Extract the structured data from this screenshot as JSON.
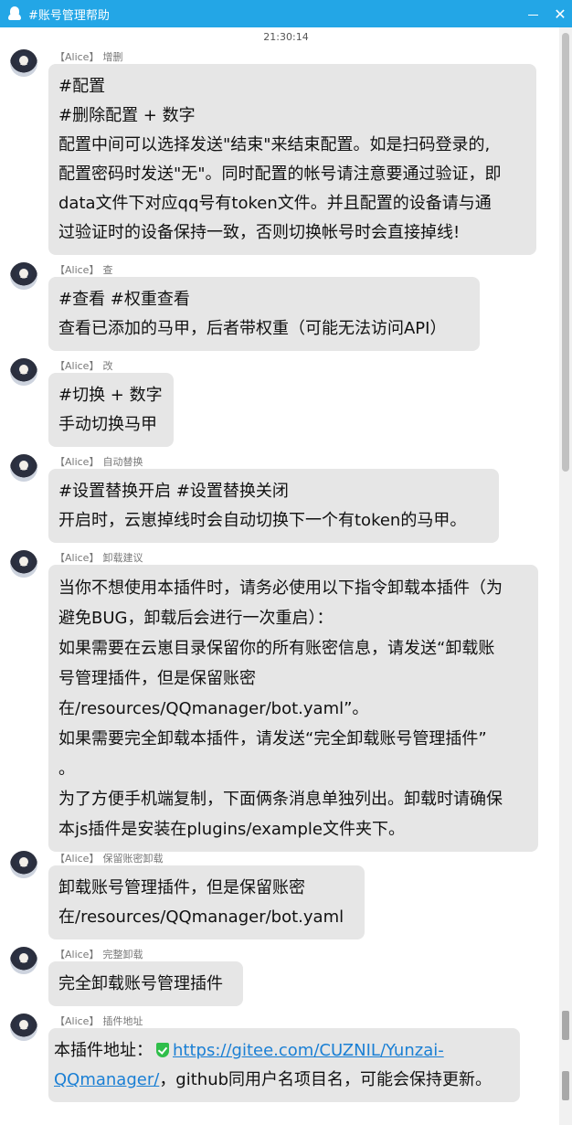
{
  "window": {
    "title": "#账号管理帮助",
    "minimize_glyph": "",
    "close_glyph": "✕"
  },
  "chat": {
    "timestamp": "21:30:14",
    "messages": [
      {
        "name": "【Alice】",
        "role": "增删",
        "lines": [
          "#配置",
          "#删除配置 + 数字",
          "配置中间可以选择发送\"结束\"来结束配置。如是扫码登录的,",
          "配置密码时发送\"无\"。同时配置的帐号请注意要通过验证，即",
          "data文件下对应qq号有token文件。并且配置的设备请与通",
          "过验证时的设备保持一致，否则切换帐号时会直接掉线!"
        ]
      },
      {
        "name": "【Alice】",
        "role": "查",
        "lines": [
          "#查看 #权重查看",
          "查看已添加的马甲，后者带权重（可能无法访问API）"
        ]
      },
      {
        "name": "【Alice】",
        "role": "改",
        "lines": [
          "#切换 + 数字",
          "手动切换马甲"
        ]
      },
      {
        "name": "【Alice】",
        "role": "自动替换",
        "lines": [
          "#设置替换开启 #设置替换关闭",
          "开启时，云崽掉线时会自动切换下一个有token的马甲。"
        ]
      },
      {
        "name": "【Alice】",
        "role": "卸载建议",
        "lines": [
          "当你不想使用本插件时，请务必使用以下指令卸载本插件（为",
          "避免BUG，卸载后会进行一次重启）：",
          "如果需要在云崽目录保留你的所有账密信息，请发送“卸载账",
          "号管理插件，但是保留账密",
          "在/resources/QQmanager/bot.yaml”。",
          "如果需要完全卸载本插件，请发送“完全卸载账号管理插件”",
          "。",
          "为了方便手机端复制，下面俩条消息单独列出。卸载时请确保",
          "本js插件是安装在plugins/example文件夹下。"
        ]
      },
      {
        "name": "【Alice】",
        "role": "保留账密卸载",
        "lines": [
          "卸载账号管理插件，但是保留账密",
          "在/resources/QQmanager/bot.yaml"
        ]
      },
      {
        "name": "【Alice】",
        "role": "完整卸载",
        "lines": [
          "完全卸载账号管理插件"
        ]
      },
      {
        "name": "【Alice】",
        "role": "插件地址",
        "prefix": "本插件地址：",
        "link_line1": "https://gitee.com/CUZNIL/Yunzai-",
        "link_line2": "QQmanager/",
        "suffix": "，github同用户名项目名，可能会保持更新。",
        "safe_icon": "shield-check-icon"
      }
    ]
  },
  "colors": {
    "titlebar": "#23a6e6",
    "bubble": "#e6e6e6",
    "link": "#1a7fd4",
    "safe": "#2fbe4a"
  }
}
